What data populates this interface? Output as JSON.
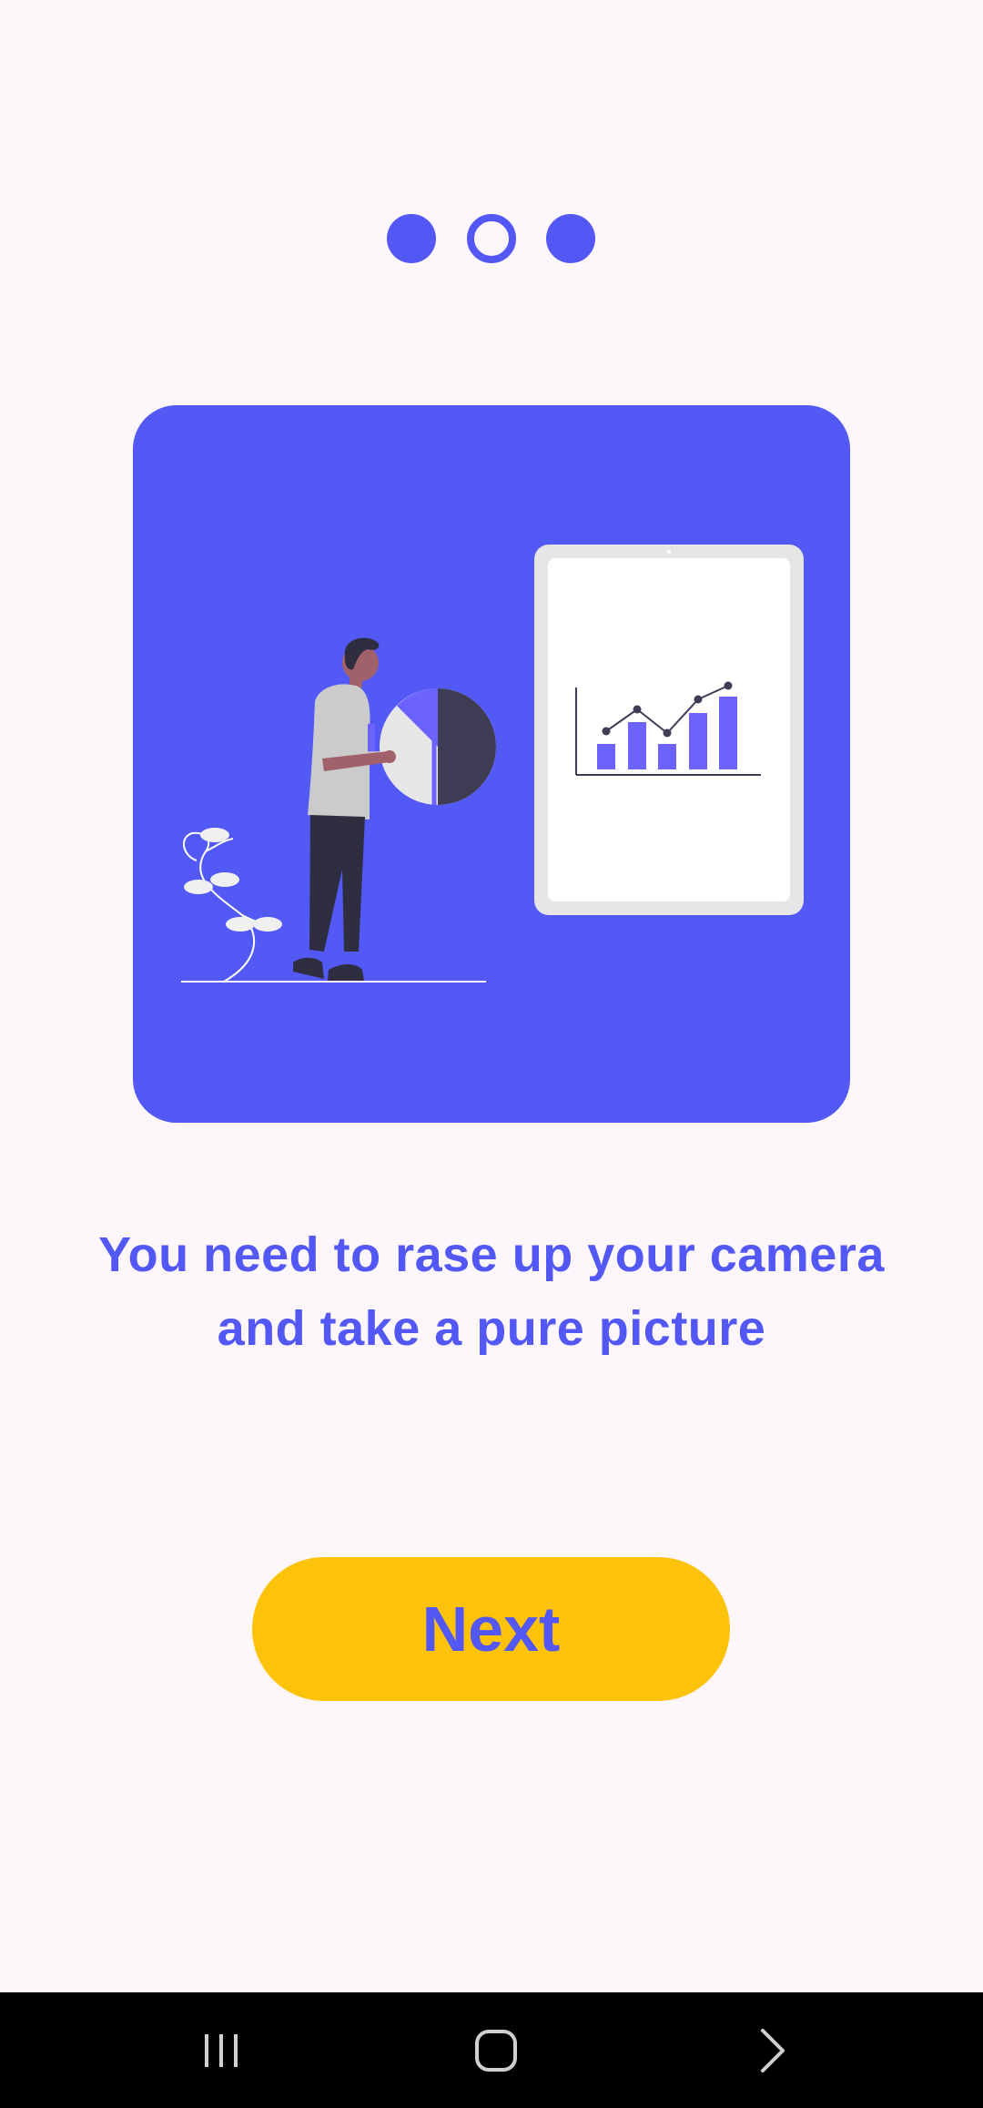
{
  "pager": {
    "pages": 3,
    "current_page": 2
  },
  "illustration": {
    "name": "person-presenting-analytics-illustration",
    "card_color": "#5359f5"
  },
  "onboarding": {
    "description": "You need to rase up your camera and take a pure picture",
    "next_label": "Next"
  },
  "colors": {
    "background": "#fdf6fb",
    "accent": "#5358f5",
    "button": "#fdc20a",
    "navbar": "#000000"
  },
  "system_nav": {
    "recents_icon": "recents-icon",
    "home_icon": "home-icon",
    "back_icon": "back-icon"
  }
}
